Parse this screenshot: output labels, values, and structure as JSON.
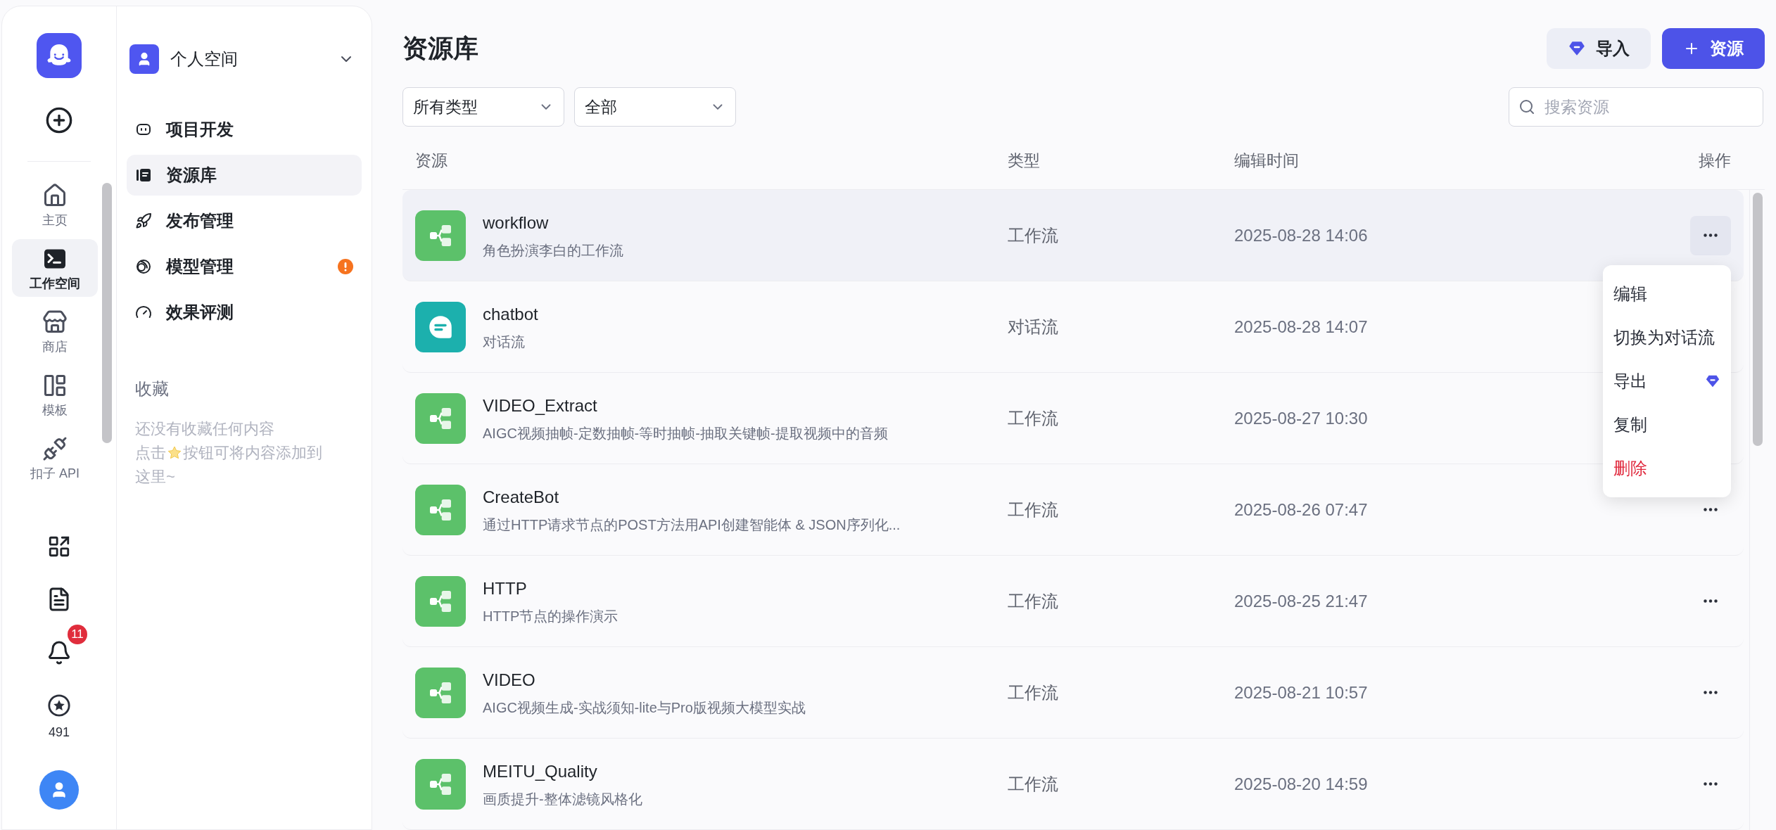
{
  "rail": {
    "nav": [
      {
        "label": "主页",
        "selected": false
      },
      {
        "label": "工作空间",
        "selected": true
      },
      {
        "label": "商店",
        "selected": false
      },
      {
        "label": "模板",
        "selected": false
      },
      {
        "label": "扣子 API",
        "selected": false
      }
    ],
    "notification_badge": "11",
    "points": "491"
  },
  "sidebar": {
    "space": "个人空间",
    "items": [
      {
        "label": "项目开发",
        "selected": false,
        "alert": false
      },
      {
        "label": "资源库",
        "selected": true,
        "alert": false
      },
      {
        "label": "发布管理",
        "selected": false,
        "alert": false
      },
      {
        "label": "模型管理",
        "selected": false,
        "alert": true
      },
      {
        "label": "效果评测",
        "selected": false,
        "alert": false
      }
    ],
    "favorites": {
      "title": "收藏",
      "empty_line_1": "还没有收藏任何内容",
      "empty_before_star": "点击",
      "empty_after_star": "按钮可将内容添加到",
      "empty_line_3": "这里~"
    }
  },
  "main": {
    "title": "资源库",
    "import_button": "导入",
    "add_button": "资源",
    "filters": [
      {
        "value": "所有类型"
      },
      {
        "value": "全部"
      }
    ],
    "search": {
      "placeholder": "搜索资源"
    },
    "columns": [
      "资源",
      "类型",
      "编辑时间",
      "操作"
    ],
    "rows": [
      {
        "kind": "workflow",
        "name": "workflow",
        "description": "角色扮演李白的工作流",
        "type": "工作流",
        "time": "2025-08-28 14:06",
        "selected": true
      },
      {
        "kind": "chatflow",
        "name": "chatbot",
        "description": "对话流",
        "type": "对话流",
        "time": "2025-08-28 14:07",
        "selected": false
      },
      {
        "kind": "workflow",
        "name": "VIDEO_Extract",
        "description": "AIGC视频抽帧-定数抽帧-等时抽帧-抽取关键帧-提取视频中的音频",
        "type": "工作流",
        "time": "2025-08-27 10:30",
        "selected": false
      },
      {
        "kind": "workflow",
        "name": "CreateBot",
        "description": "通过HTTP请求节点的POST方法用API创建智能体 & JSON序列化...",
        "type": "工作流",
        "time": "2025-08-26 07:47",
        "selected": false
      },
      {
        "kind": "workflow",
        "name": "HTTP",
        "description": "HTTP节点的操作演示",
        "type": "工作流",
        "time": "2025-08-25 21:47",
        "selected": false
      },
      {
        "kind": "workflow",
        "name": "VIDEO",
        "description": "AIGC视频生成-实战须知-lite与Pro版视频大模型实战",
        "type": "工作流",
        "time": "2025-08-21 10:57",
        "selected": false
      },
      {
        "kind": "workflow",
        "name": "MEITU_Quality",
        "description": "画质提升-整体滤镜风格化",
        "type": "工作流",
        "time": "2025-08-20 14:59",
        "selected": false
      }
    ],
    "menu": [
      {
        "label": "编辑",
        "kind": "normal"
      },
      {
        "label": "切换为对话流",
        "kind": "normal"
      },
      {
        "label": "导出",
        "kind": "premium"
      },
      {
        "label": "复制",
        "kind": "normal"
      },
      {
        "label": "删除",
        "kind": "danger"
      }
    ]
  }
}
